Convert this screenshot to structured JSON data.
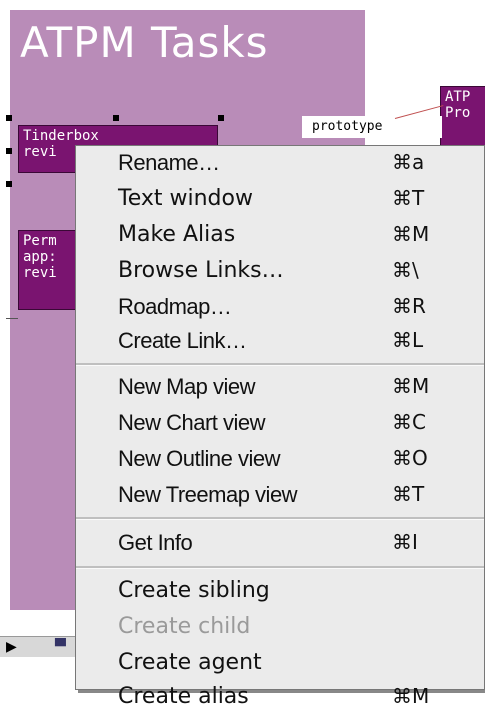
{
  "window": {
    "title": "ATPM Tasks"
  },
  "notes": {
    "tinderbox": "Tinderbox\nrevi",
    "perm": "Perm\napp:\nrevi",
    "atpm": "ATP\nPro"
  },
  "prototype_label": "prototype",
  "scroll": {
    "right_arrow": "▶",
    "left_arrow": "◀"
  },
  "menu": {
    "items": [
      {
        "label": "Rename…",
        "key": "⌘a"
      },
      {
        "label": "Text window",
        "key": "⌘T"
      },
      {
        "label": "Make Alias",
        "key": "⌘M"
      },
      {
        "label": "Browse Links…",
        "key": "⌘\\"
      },
      {
        "label": "Roadmap…",
        "key": "⌘R"
      },
      {
        "label": "Create Link…",
        "key": "⌘L"
      },
      {
        "label": "New Map view",
        "key": "⌘M"
      },
      {
        "label": "New Chart view",
        "key": "⌘C"
      },
      {
        "label": "New Outline view",
        "key": "⌘O"
      },
      {
        "label": "New Treemap view",
        "key": "⌘T"
      },
      {
        "label": "Get Info",
        "key": "⌘I"
      },
      {
        "label": "Create sibling",
        "key": ""
      },
      {
        "label": "Create child",
        "key": "",
        "disabled": true
      },
      {
        "label": "Create agent",
        "key": ""
      },
      {
        "label": "Create alias",
        "key": "⌘M"
      }
    ]
  }
}
